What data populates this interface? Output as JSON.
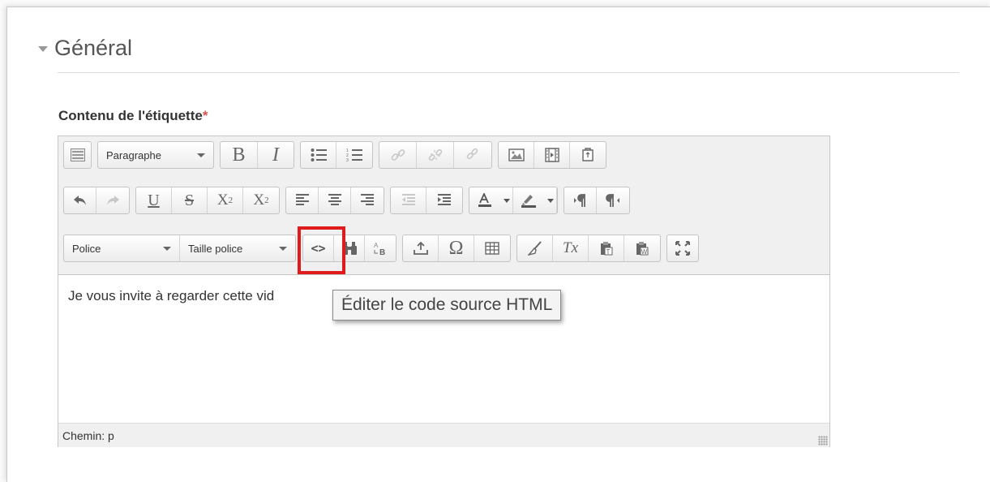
{
  "section": {
    "title": "Général"
  },
  "field": {
    "label": "Contenu de l'étiquette",
    "required_mark": "*"
  },
  "toolbar": {
    "format_select": "Paragraphe",
    "font_select": "Police",
    "size_select": "Taille police",
    "bold": "B",
    "italic": "I",
    "underline": "U",
    "strike": "S",
    "subscript": "X",
    "subscript_sub": "2",
    "superscript": "X",
    "superscript_sup": "2",
    "source_code": "<>",
    "omega": "Ω",
    "remove_format": "Tx",
    "highlighted_button": "source-code-button"
  },
  "editor": {
    "content": "Je vous invite à regarder cette vid"
  },
  "tooltip": {
    "text": "Éditer le code source HTML"
  },
  "status": {
    "path": "Chemin: p"
  },
  "colors": {
    "highlight": "#e01b1b",
    "required": "#d9534f"
  }
}
